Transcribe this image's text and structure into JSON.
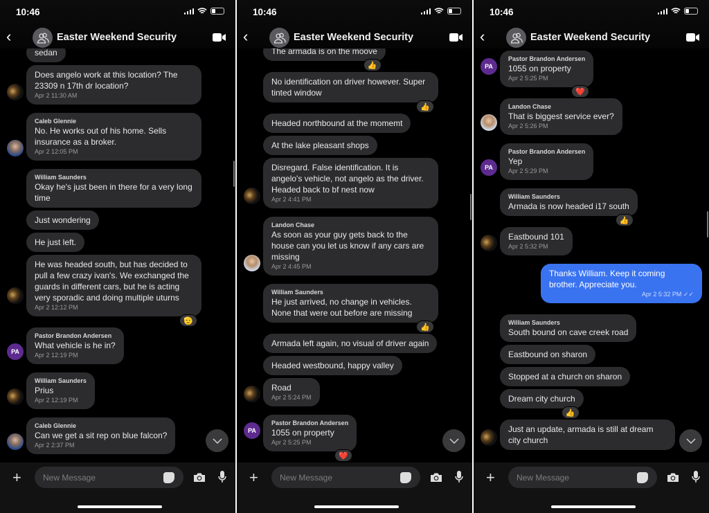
{
  "status_time": "10:46",
  "conversation_title": "Easter Weekend Security",
  "input_placeholder": "New Message",
  "colors": {
    "background": "#000000",
    "incoming_bubble": "#2c2c2e",
    "outgoing_bubble": "#3a73f0",
    "pa_avatar": "#5d2b8f"
  },
  "icons": {
    "back": "chevron-left",
    "group": "people-icon",
    "video": "video-camera",
    "add": "plus",
    "sticker": "sticker",
    "camera": "camera",
    "mic": "microphone",
    "scroll_down": "chevron-down"
  },
  "panels": [
    {
      "groups": [
        {
          "avatar": "ws",
          "messages": [
            {
              "text": "sedan"
            },
            {
              "text": "Does angelo work at this location? The 23309 n 17th dr location?",
              "time": "Apr 2 11:30 AM"
            }
          ]
        },
        {
          "sender": "Caleb Glennie",
          "avatar": "cg",
          "messages": [
            {
              "text": "No. He works out of his home. Sells insurance as a broker.",
              "time": "Apr 2 12:05 PM"
            }
          ]
        },
        {
          "sender": "William Saunders",
          "avatar": "ws",
          "messages": [
            {
              "text": "Okay he's just been in there for a very long time"
            },
            {
              "text": "Just wondering"
            },
            {
              "text": "He just left."
            },
            {
              "text": "He was headed south, but has decided to pull a few crazy ivan's. We exchanged the guards in different cars, but he is acting very sporadic and doing multiple uturns",
              "time": "Apr 2 12:12 PM",
              "reaction": "🫡"
            }
          ]
        },
        {
          "sender": "Pastor Brandon Andersen",
          "avatar": "pa",
          "avatar_initials": "PA",
          "messages": [
            {
              "text": "What vehicle is he in?",
              "time": "Apr 2 12:19 PM"
            }
          ]
        },
        {
          "sender": "William Saunders",
          "avatar": "ws",
          "messages": [
            {
              "text": "Prius",
              "time": "Apr 2 12:19 PM"
            }
          ]
        },
        {
          "sender": "Caleb Glennie",
          "avatar": "cg",
          "messages": [
            {
              "text": "Can we get a sit rep on blue falcon?",
              "time": "Apr 2 2:37 PM"
            }
          ]
        }
      ]
    },
    {
      "groups": [
        {
          "avatar": "ws",
          "messages": [
            {
              "text": "The armada is on the moove",
              "reaction": "👍"
            },
            {
              "text": "No identification on driver however.  Super tinted window",
              "reaction": "👍"
            },
            {
              "text": "Headed northbound at the momemt"
            },
            {
              "text": "At the lake pleasant shops"
            },
            {
              "text": "Disregard.  False identification.  It is angelo's vehicle, not angelo as the driver. Headed back to bf nest now",
              "time": "Apr 2 4:41 PM"
            }
          ]
        },
        {
          "sender": "Landon Chase",
          "avatar": "lc",
          "messages": [
            {
              "text": "As soon as your guy gets back to the house can you let us know if any cars are missing",
              "time": "Apr 2 4:45 PM"
            }
          ]
        },
        {
          "sender": "William Saunders",
          "avatar": "ws",
          "messages": [
            {
              "text": "He just arrived, no change in vehicles. None that were out before are missing",
              "reaction": "👍"
            },
            {
              "text": "Armada left again, no visual of driver again"
            },
            {
              "text": "Headed westbound, happy valley"
            },
            {
              "text": "Road",
              "time": "Apr 2 5:24 PM"
            }
          ]
        },
        {
          "sender": "Pastor Brandon Andersen",
          "avatar": "pa",
          "avatar_initials": "PA",
          "messages": [
            {
              "text": "1055 on property",
              "time": "Apr 2 5:25 PM",
              "reaction": "❤️"
            }
          ]
        }
      ]
    },
    {
      "groups": [
        {
          "sender": "Pastor Brandon Andersen",
          "avatar": "pa",
          "avatar_initials": "PA",
          "messages": [
            {
              "text": "1055 on property",
              "time": "Apr 2 5:25 PM",
              "reaction": "❤️"
            }
          ]
        },
        {
          "sender": "Landon Chase",
          "avatar": "lc",
          "messages": [
            {
              "text": "That is biggest service ever?",
              "time": "Apr 2 5:26 PM"
            }
          ]
        },
        {
          "sender": "Pastor Brandon Andersen",
          "avatar": "pa",
          "avatar_initials": "PA",
          "messages": [
            {
              "text": "Yep",
              "time": "Apr 2 5:29 PM"
            }
          ]
        },
        {
          "sender": "William Saunders",
          "avatar": "ws",
          "messages": [
            {
              "text": "Armada is now headed i17 south",
              "reaction": "👍"
            },
            {
              "text": "Eastbound 101",
              "time": "Apr 2 5:32 PM"
            }
          ]
        },
        {
          "outgoing": true,
          "messages": [
            {
              "text": "Thanks William. Keep it coming brother. Appreciate you.",
              "time": "Apr 2 5:32 PM",
              "status": "read"
            }
          ]
        },
        {
          "sender": "William Saunders",
          "avatar": "ws",
          "messages": [
            {
              "text": "South bound on cave creek road"
            },
            {
              "text": "Eastbound on sharon"
            },
            {
              "text": "Stopped at a church on sharon"
            },
            {
              "text": "Dream city church",
              "reaction": "👍"
            },
            {
              "text": "Just an update, armada is still at dream city church"
            }
          ]
        }
      ]
    }
  ]
}
